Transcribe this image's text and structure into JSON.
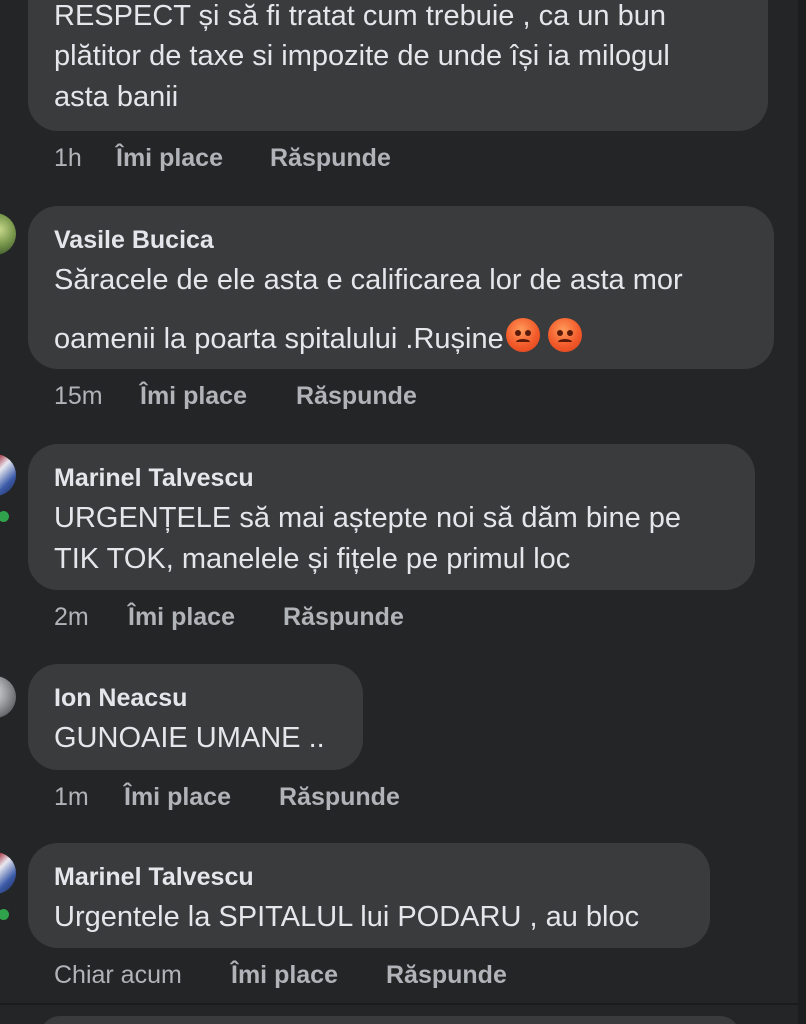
{
  "comments": [
    {
      "author": "",
      "lines": [
        "RESPECT și să fi tratat cum trebuie , ca un bun",
        "plătitor de taxe si impozite de unde își ia milogul",
        "asta banii"
      ],
      "time": "1h",
      "like": "Îmi place",
      "reply": "Răspunde"
    },
    {
      "author": "Vasile Bucica",
      "lines": [
        "Săracele de ele asta e calificarea lor de asta mor",
        "oamenii la poarta spitalului .Rușine"
      ],
      "emoji": [
        "angry-face-icon",
        "angry-face-icon"
      ],
      "time": "15m",
      "like": "Îmi place",
      "reply": "Răspunde"
    },
    {
      "author": "Marinel Talvescu",
      "lines": [
        "URGENȚELE să mai aștepte noi să dăm bine pe",
        "TIK TOK, manelele și fițele pe primul loc"
      ],
      "time": "2m",
      "like": "Îmi place",
      "reply": "Răspunde"
    },
    {
      "author": "Ion Neacsu",
      "lines": [
        "GUNOAIE UMANE .."
      ],
      "time": "1m",
      "like": "Îmi place",
      "reply": "Răspunde"
    },
    {
      "author": "Marinel Talvescu",
      "lines": [
        "Urgentele la SPITALUL lui PODARU , au bloc"
      ],
      "time": "Chiar acum",
      "like": "Îmi place",
      "reply": "Răspunde"
    }
  ],
  "colors": {
    "background": "#242526",
    "bubble": "#3a3b3c",
    "text": "#e4e6eb",
    "meta": "#b0b3b8",
    "presence": "#31a24c"
  }
}
